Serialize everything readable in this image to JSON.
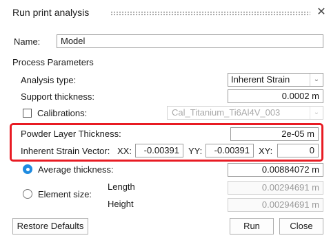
{
  "dialog": {
    "title": "Run print analysis",
    "close_glyph": "✕",
    "name_label": "Name:",
    "name_value": "Model",
    "section_title": "Process Parameters",
    "analysis_type_label": "Analysis type:",
    "analysis_type_value": "Inherent Strain",
    "support_thickness_label": "Support thickness:",
    "support_thickness_value": "0.0002 m",
    "calibrations_label": "Calibrations:",
    "calibrations_value": "Cal_Titanium_Ti6Al4V_003",
    "powder_layer_label": "Powder Layer Thickness:",
    "powder_layer_value": "2e-05 m",
    "strain_vector_label": "Inherent Strain Vector:",
    "xx_label": "XX:",
    "xx_value": "-0.00391",
    "yy_label": "YY:",
    "yy_value": "-0.00391",
    "xy_label": "XY:",
    "xy_value": "0",
    "avg_thickness_label": "Average thickness:",
    "avg_thickness_value": "0.00884072 m",
    "element_size_label": "Element size:",
    "length_label": "Length",
    "length_value": "0.00294691 m",
    "height_label": "Height",
    "height_value": "0.00294691 m",
    "restore_label": "Restore Defaults",
    "run_label": "Run",
    "close_label": "Close",
    "dropdown_glyph": "⌄",
    "highlight_color": "#e81b23",
    "accent_color": "#1f8be0"
  }
}
